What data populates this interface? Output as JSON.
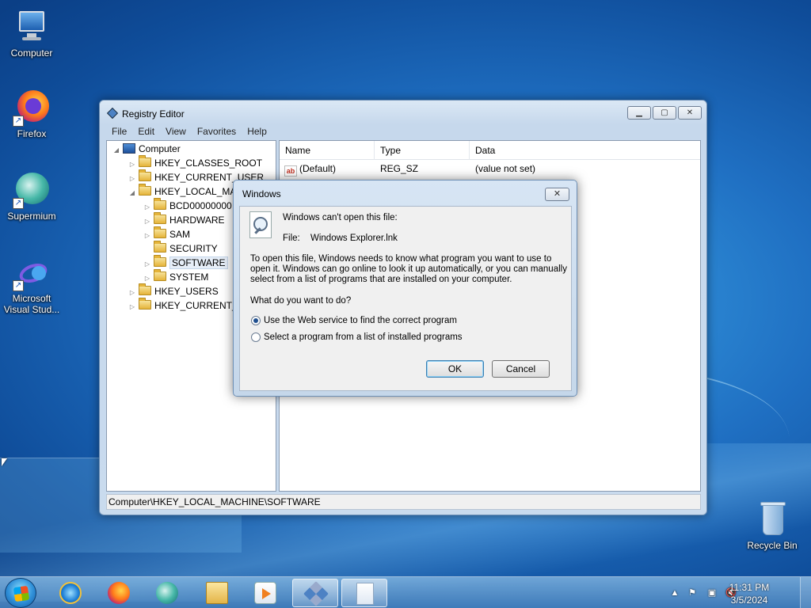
{
  "desktop": {
    "icons": [
      {
        "label": "Computer",
        "icon": "computer-icon"
      },
      {
        "label": "Firefox",
        "icon": "firefox-icon"
      },
      {
        "label": "Supermium",
        "icon": "supermium-icon"
      },
      {
        "label": "Microsoft Visual Stud...",
        "icon": "visual-studio-icon"
      },
      {
        "label": "Recycle Bin",
        "icon": "recycle-bin-icon"
      }
    ]
  },
  "regedit": {
    "title": "Registry Editor",
    "menu": [
      "File",
      "Edit",
      "View",
      "Favorites",
      "Help"
    ],
    "tree": {
      "root": "Computer",
      "hives": [
        "HKEY_CLASSES_ROOT",
        "HKEY_CURRENT_USER",
        "HKEY_LOCAL_MAC",
        "HKEY_USERS",
        "HKEY_CURRENT_C"
      ],
      "children": [
        "BCD00000000",
        "HARDWARE",
        "SAM",
        "SECURITY",
        "SOFTWARE",
        "SYSTEM"
      ]
    },
    "columns": [
      "Name",
      "Type",
      "Data"
    ],
    "rows": [
      {
        "name": "(Default)",
        "type": "REG_SZ",
        "data": "(value not set)"
      }
    ],
    "status": "Computer\\HKEY_LOCAL_MACHINE\\SOFTWARE"
  },
  "dialog": {
    "title": "Windows",
    "heading": "Windows can't open this file:",
    "file_label": "File:",
    "file_name": "Windows Explorer.lnk",
    "desc_line1": "To open this file, Windows needs to know what program you want to use to",
    "desc_line2": "open it. Windows can go online to look it up automatically, or you can manually",
    "desc_line3": "select from a list of programs that are installed on your computer.",
    "question": "What do you want to do?",
    "option1": "Use the Web service to find the correct program",
    "option2": "Select a program from a list of installed programs",
    "ok": "OK",
    "cancel": "Cancel"
  },
  "taskbar": {
    "time": "11:31 PM",
    "date": "3/5/2024"
  }
}
